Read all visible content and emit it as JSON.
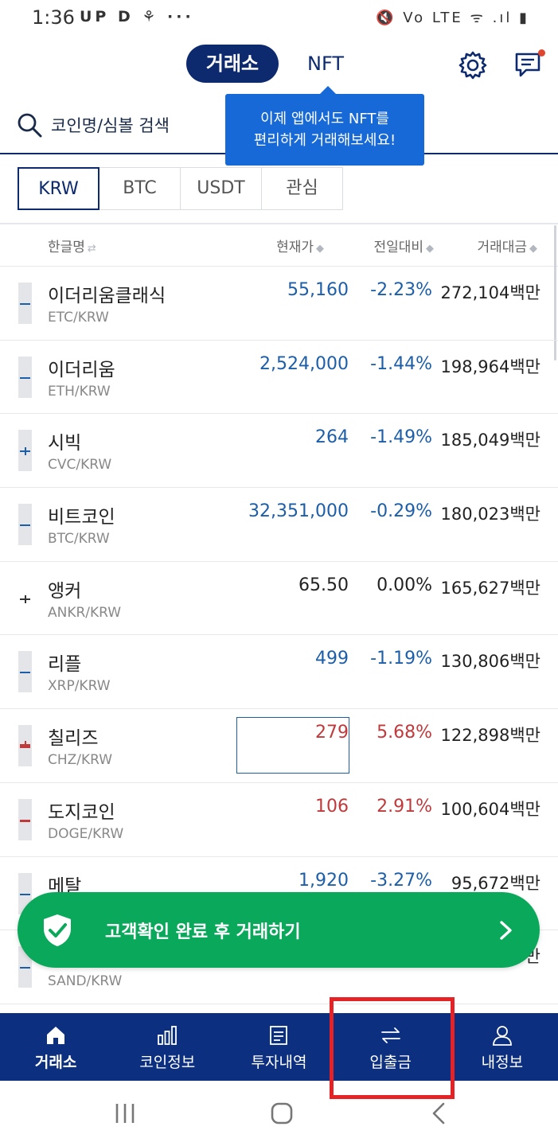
{
  "status_bar": {
    "time": "1:36",
    "left_icons": "UP D ⚘ ···",
    "right_icons": "🔇 Vo LTE ᯤ .ıl ▮"
  },
  "header": {
    "tab_exchange": "거래소",
    "tab_nft": "NFT",
    "icons": [
      "gear-icon",
      "chat-icon"
    ]
  },
  "tooltip": {
    "line1": "이제 앱에서도 NFT를",
    "line2": "편리하게 거래해보세요!"
  },
  "search": {
    "placeholder": "코인명/심볼 검색"
  },
  "market_tabs": [
    "KRW",
    "BTC",
    "USDT",
    "관심"
  ],
  "columns": {
    "name": "한글명",
    "price": "현재가",
    "change": "전일대비",
    "volume": "거래대금"
  },
  "coins": [
    {
      "name": "이더리움클래식",
      "symbol": "ETC/KRW",
      "price": "55,160",
      "change": "-2.23%",
      "volume": "272,104백만",
      "direction": "down"
    },
    {
      "name": "이더리움",
      "symbol": "ETH/KRW",
      "price": "2,524,000",
      "change": "-1.44%",
      "volume": "198,964백만",
      "direction": "down"
    },
    {
      "name": "시빅",
      "symbol": "CVC/KRW",
      "price": "264",
      "change": "-1.49%",
      "volume": "185,049백만",
      "direction": "down"
    },
    {
      "name": "비트코인",
      "symbol": "BTC/KRW",
      "price": "32,351,000",
      "change": "-0.29%",
      "volume": "180,023백만",
      "direction": "down"
    },
    {
      "name": "앵커",
      "symbol": "ANKR/KRW",
      "price": "65.50",
      "change": "0.00%",
      "volume": "165,627백만",
      "direction": "even"
    },
    {
      "name": "리플",
      "symbol": "XRP/KRW",
      "price": "499",
      "change": "-1.19%",
      "volume": "130,806백만",
      "direction": "down"
    },
    {
      "name": "칠리즈",
      "symbol": "CHZ/KRW",
      "price": "279",
      "change": "5.68%",
      "volume": "122,898백만",
      "direction": "rise"
    },
    {
      "name": "도지코인",
      "symbol": "DOGE/KRW",
      "price": "106",
      "change": "2.91%",
      "volume": "100,604백만",
      "direction": "rise"
    },
    {
      "name": "메탈",
      "symbol": "",
      "price": "1,920",
      "change": "-3.27%",
      "volume": "95,672백만",
      "direction": "down"
    },
    {
      "name": "",
      "symbol": "SAND/KRW",
      "price": "",
      "change": "",
      "volume": "만",
      "direction": "down"
    }
  ],
  "kyc_banner": {
    "text": "고객확인 완료 후 거래하기"
  },
  "bottom_nav": [
    {
      "label": "거래소",
      "icon": "home-icon"
    },
    {
      "label": "코인정보",
      "icon": "bar-chart-icon"
    },
    {
      "label": "투자내역",
      "icon": "document-icon"
    },
    {
      "label": "입출금",
      "icon": "transfer-arrows-icon"
    },
    {
      "label": "내정보",
      "icon": "user-icon"
    }
  ],
  "colors": {
    "navy": "#0d2a6e",
    "nav_blue": "#0d2f7f",
    "fall_blue": "#1c5ea8",
    "rise_red": "#c0393b",
    "kyc_green": "#0aa85a",
    "tooltip_blue": "#1669d6",
    "highlight_red": "#e52226"
  }
}
